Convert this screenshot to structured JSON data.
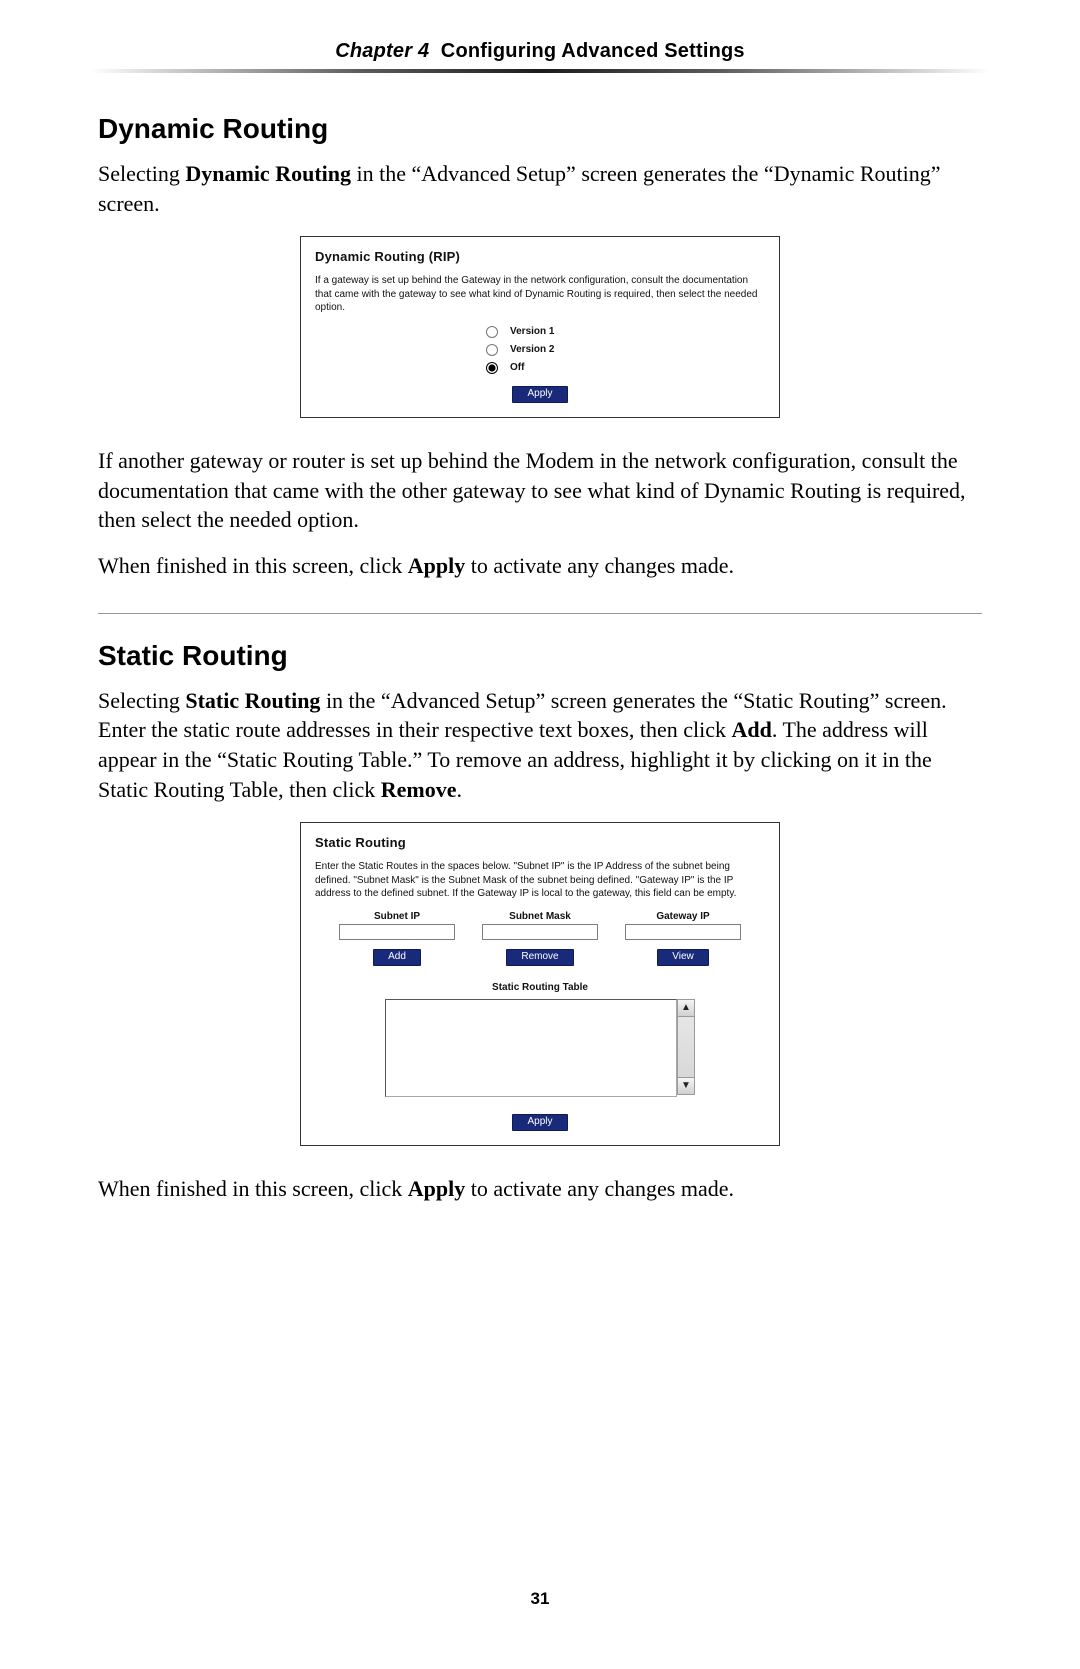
{
  "header": {
    "chapter_prefix": "Chapter 4",
    "chapter_title": "Configuring Advanced Settings"
  },
  "section1": {
    "heading": "Dynamic Routing",
    "intro_pre": "Selecting ",
    "intro_bold": "Dynamic Routing",
    "intro_post": " in the “Advanced Setup” screen generates the “Dynamic Routing” screen.",
    "panel": {
      "title": "Dynamic Routing (RIP)",
      "desc": "If a gateway is set up behind the Gateway in the network configuration, consult the documentation that came with the gateway to see what kind of Dynamic Routing is required, then select the needed option.",
      "opt1": "Version 1",
      "opt2": "Version 2",
      "opt3": "Off",
      "apply": "Apply"
    },
    "para_after": "If another gateway or router is set up behind the Modem in the network configuration, consult the documentation that came with the other gateway to see what kind of Dynamic Routing is required, then select the needed option.",
    "finish_pre": "When finished in this screen, click ",
    "finish_bold": "Apply",
    "finish_post": " to activate any changes made."
  },
  "section2": {
    "heading": "Static Routing",
    "p_pre": "Selecting ",
    "p_b1": "Static Routing",
    "p_mid1": " in the “Advanced Setup” screen generates the “Static Routing” screen. Enter the static route addresses in their respective text boxes, then click ",
    "p_b2": "Add",
    "p_mid2": ". The address will appear in the “Static Routing Table.” To remove an address, highlight it by clicking on it in the Static Routing Table, then click ",
    "p_b3": "Remove",
    "p_post": ".",
    "panel": {
      "title": "Static Routing",
      "desc": "Enter the Static Routes in the spaces below. \"Subnet IP\" is the IP Address of the subnet being defined. \"Subnet Mask\" is the Subnet Mask of the subnet being defined. \"Gateway IP\" is the IP address to the defined subnet. If the Gateway IP is local to the gateway, this field can be empty.",
      "col1": "Subnet IP",
      "col2": "Subnet Mask",
      "col3": "Gateway IP",
      "btn_add": "Add",
      "btn_remove": "Remove",
      "btn_view": "View",
      "table_caption": "Static Routing Table",
      "apply": "Apply"
    },
    "finish_pre": "When finished in this screen, click ",
    "finish_bold": "Apply",
    "finish_post": " to activate any changes made."
  },
  "page_number": "31"
}
